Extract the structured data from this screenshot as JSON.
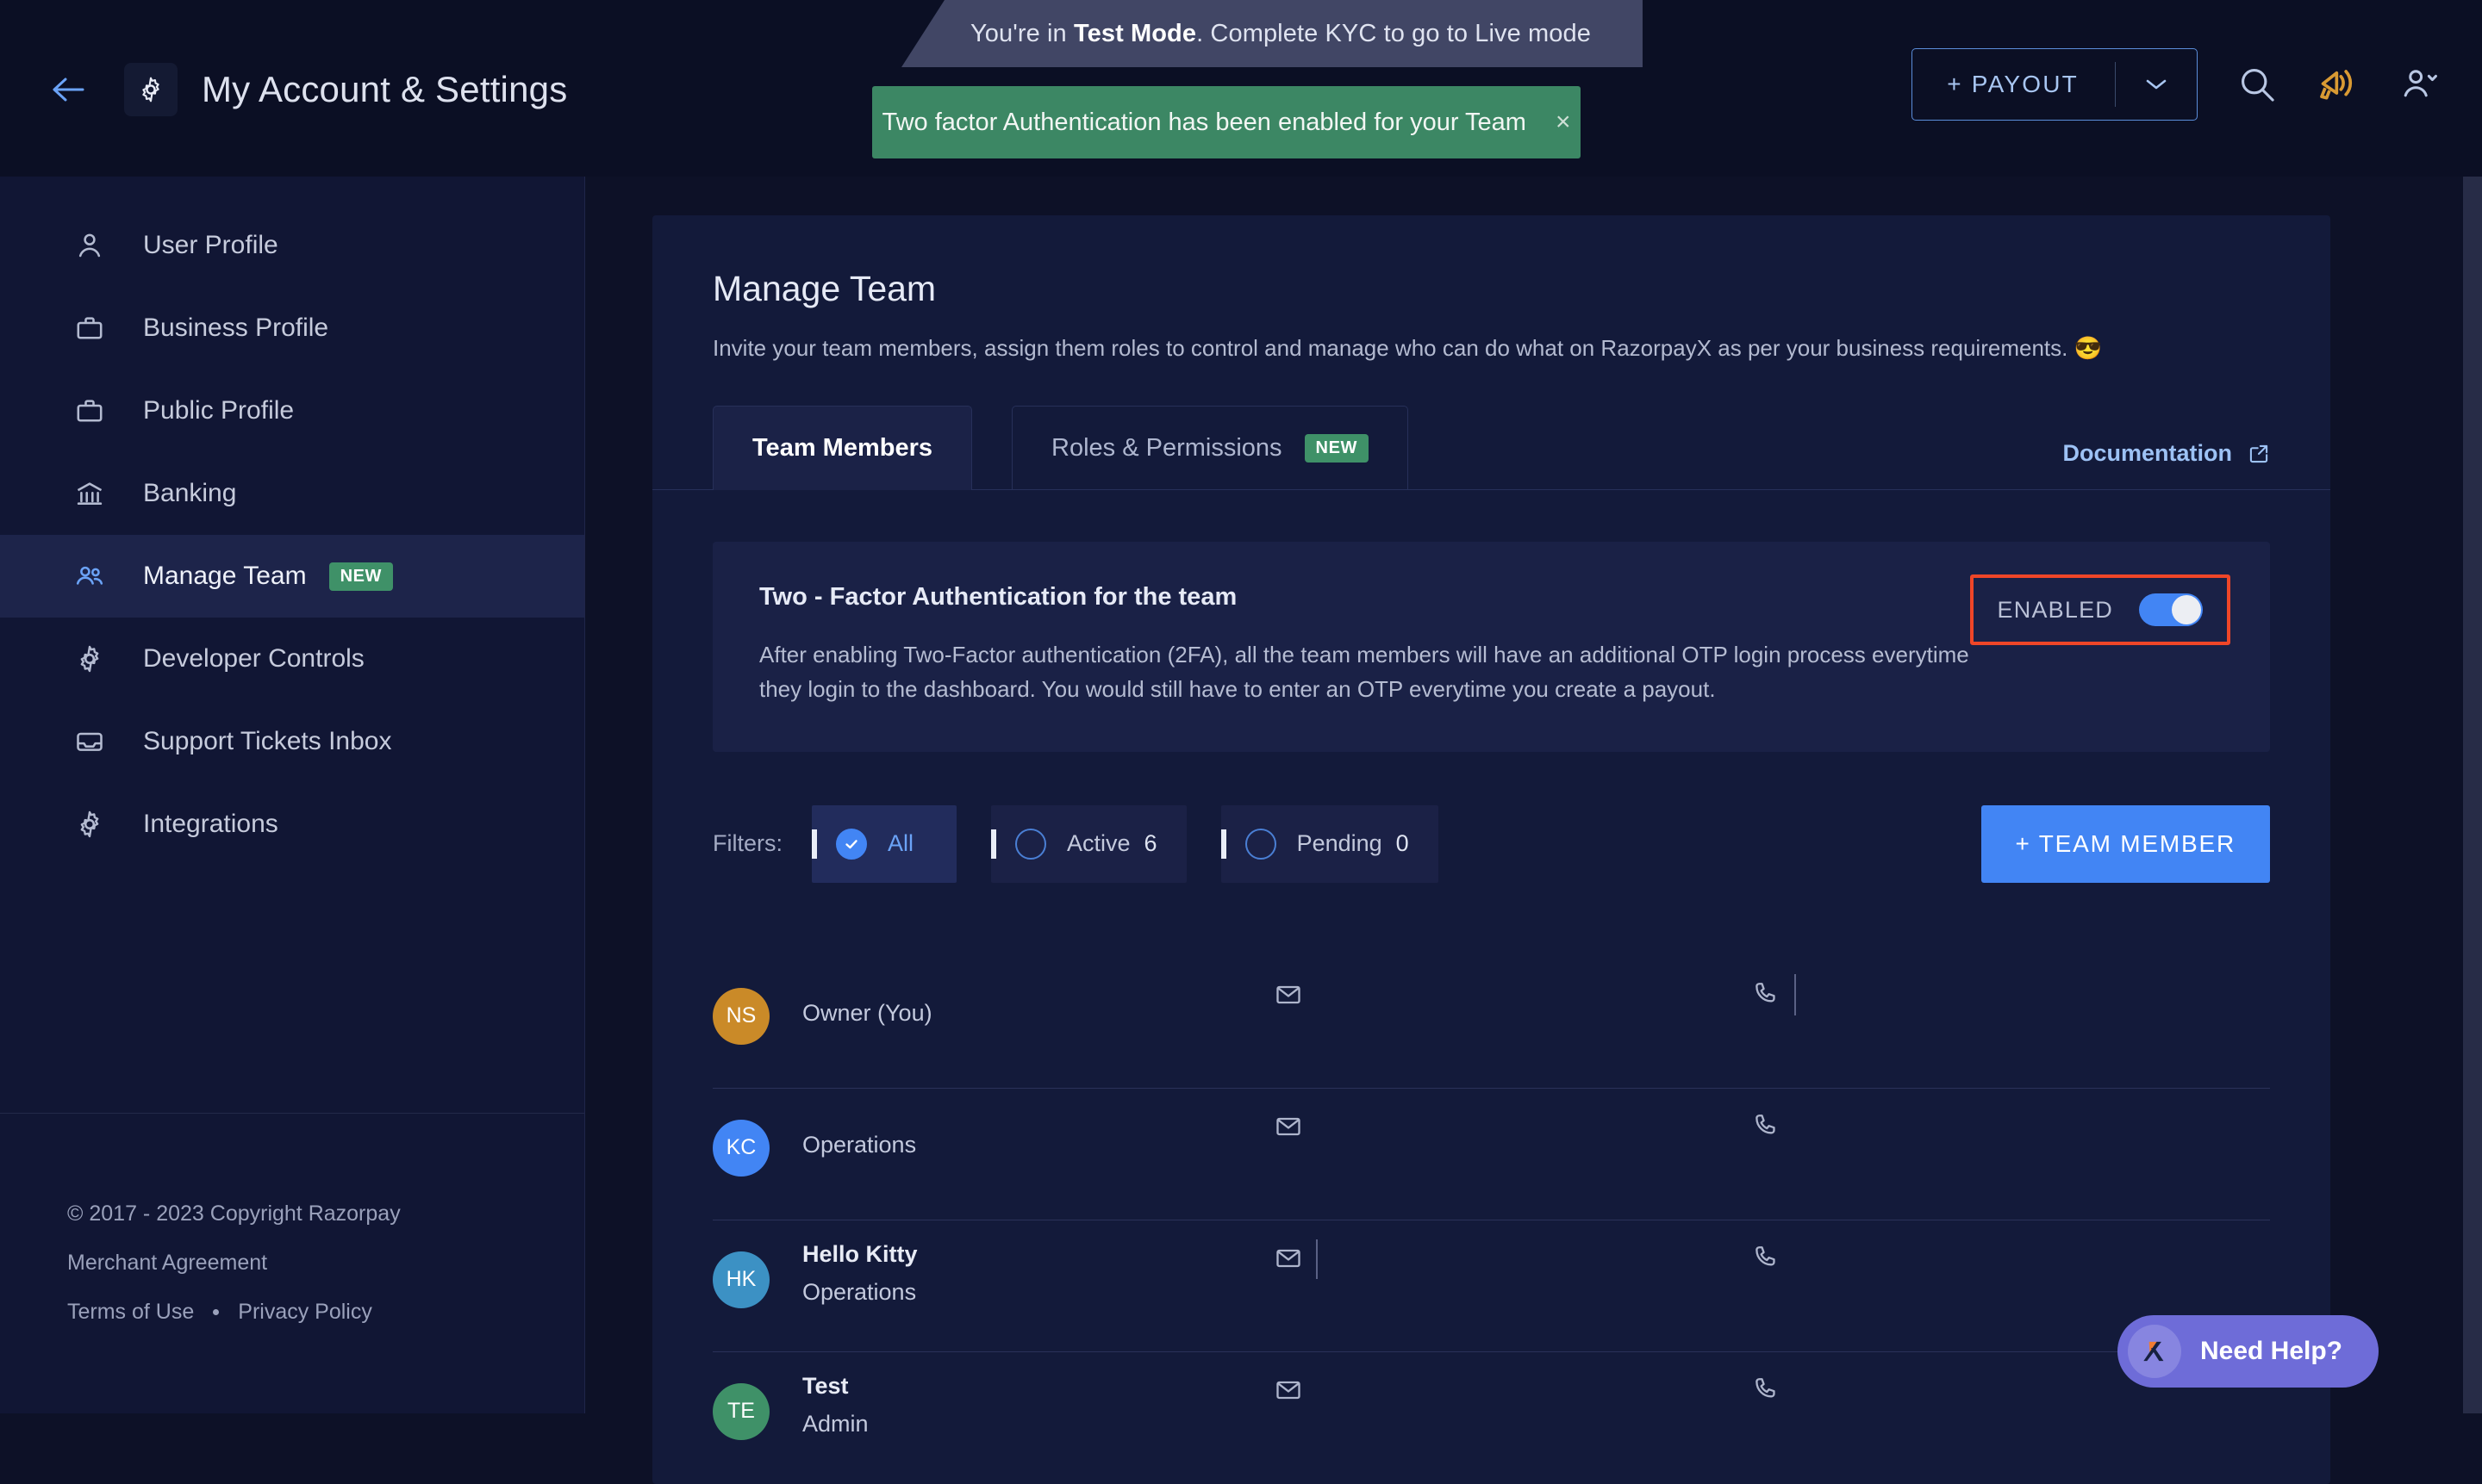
{
  "banner": {
    "prefix": "You're in ",
    "strong": "Test Mode",
    "suffix": ". Complete KYC to go to Live mode"
  },
  "toast": {
    "message": "Two factor Authentication has been enabled for your Team",
    "close_label": "×"
  },
  "header": {
    "back_icon": "arrow-left-icon",
    "gear_icon": "gear-icon",
    "title": "My Account & Settings",
    "payout_label": "+ PAYOUT",
    "payout_caret": "chevron-down-icon",
    "search_icon": "search-icon",
    "announce_icon": "megaphone-icon",
    "account_icon": "user-chevron-icon"
  },
  "sidebar": {
    "items": [
      {
        "label": "User Profile",
        "icon": "user-icon",
        "active": false,
        "badge": ""
      },
      {
        "label": "Business Profile",
        "icon": "briefcase-icon",
        "active": false,
        "badge": ""
      },
      {
        "label": "Public Profile",
        "icon": "briefcase-icon",
        "active": false,
        "badge": ""
      },
      {
        "label": "Banking",
        "icon": "bank-icon",
        "active": false,
        "badge": ""
      },
      {
        "label": "Manage Team",
        "icon": "users-icon",
        "active": true,
        "badge": "NEW"
      },
      {
        "label": "Developer Controls",
        "icon": "gear-icon",
        "active": false,
        "badge": ""
      },
      {
        "label": "Support Tickets Inbox",
        "icon": "inbox-icon",
        "active": false,
        "badge": ""
      },
      {
        "label": "Integrations",
        "icon": "gear-icon",
        "active": false,
        "badge": ""
      }
    ],
    "footer": {
      "copyright": "© 2017 - 2023 Copyright Razorpay",
      "merchant_agreement": "Merchant Agreement",
      "terms": "Terms of Use",
      "privacy": "Privacy Policy"
    }
  },
  "main": {
    "title": "Manage Team",
    "subtitle": "Invite your team members, assign them roles to control and manage who can do what on RazorpayX as per your business requirements.",
    "subtitle_emoji": "😎",
    "tabs": [
      {
        "label": "Team Members",
        "badge": "",
        "active": true
      },
      {
        "label": "Roles & Permissions",
        "badge": "NEW",
        "active": false
      }
    ],
    "documentation_label": "Documentation",
    "documentation_icon": "external-link-icon",
    "twofa": {
      "title": "Two - Factor Authentication for the team",
      "description": "After enabling Two-Factor authentication (2FA), all the team members will have an additional OTP login process everytime they login to the dashboard. You would still have to enter an OTP everytime you create a payout.",
      "state_label": "ENABLED",
      "toggle_on": true,
      "highlight_color": "#ef4628",
      "toggle_color": "#4285f4"
    },
    "filters": {
      "label": "Filters:",
      "options": [
        {
          "label": "All",
          "count": "",
          "selected": true
        },
        {
          "label": "Active",
          "count": "6",
          "selected": false
        },
        {
          "label": "Pending",
          "count": "0",
          "selected": false
        }
      ]
    },
    "add_member_label": "+ TEAM MEMBER",
    "members": [
      {
        "initials": "NS",
        "color": "#ca8a28",
        "name": "",
        "role": "Owner (You)",
        "mail_icon": "mail-icon",
        "phone_icon": "phone-icon"
      },
      {
        "initials": "KC",
        "color": "#4285f4",
        "name": "",
        "role": "Operations",
        "mail_icon": "mail-icon",
        "phone_icon": "phone-icon"
      },
      {
        "initials": "HK",
        "color": "#3c91c4",
        "name": "Hello Kitty",
        "role": "Operations",
        "mail_icon": "mail-icon",
        "phone_icon": "phone-icon"
      },
      {
        "initials": "TE",
        "color": "#3f9168",
        "name": "Test",
        "role": "Admin",
        "mail_icon": "mail-icon",
        "phone_icon": "phone-icon"
      }
    ]
  },
  "need_help": {
    "label": "Need Help?",
    "icon": "razorpay-x-icon",
    "color": "#6e6cd8"
  }
}
